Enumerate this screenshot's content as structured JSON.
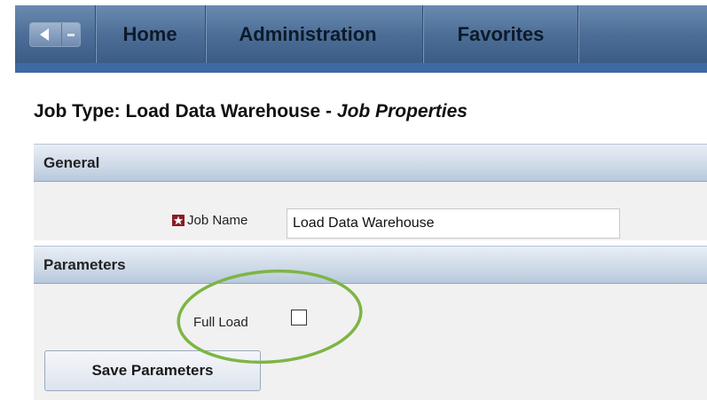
{
  "nav": {
    "tabs": [
      {
        "label": "Home"
      },
      {
        "label": "Administration"
      },
      {
        "label": "Favorites"
      }
    ],
    "icons": {
      "back": "back-arrow-icon",
      "dropdown": "chevron-down-icon"
    }
  },
  "page": {
    "title_prefix": "Job Type: Load Data Warehouse - ",
    "title_emphasis": "Job Properties"
  },
  "general": {
    "header": "General",
    "job_name_label": "Job Name",
    "job_name_value": "Load Data Warehouse",
    "required_icon": "required-star-icon"
  },
  "parameters": {
    "header": "Parameters",
    "full_load_label": "Full Load",
    "full_load_checked": false
  },
  "actions": {
    "save_label": "Save Parameters"
  },
  "annotation": {
    "shape": "ellipse",
    "color": "#7db544"
  },
  "colors": {
    "nav_bar": "#4d6f97",
    "nav_strip": "#3e6aa3",
    "required_icon": "#8b1c25"
  }
}
